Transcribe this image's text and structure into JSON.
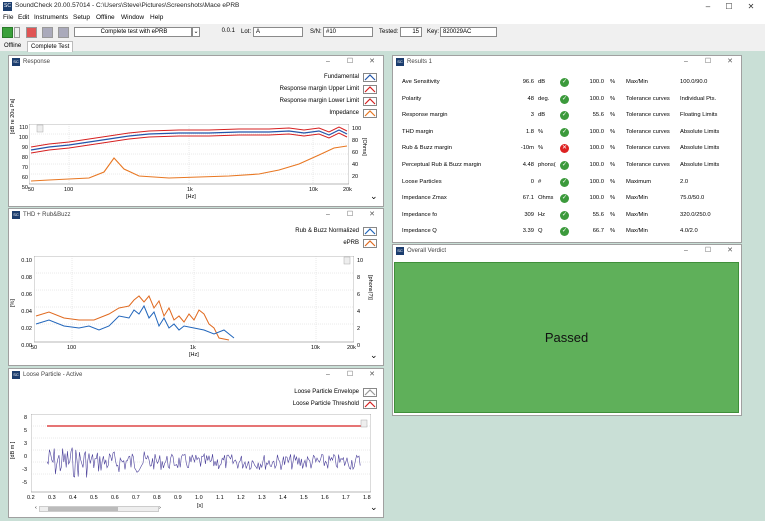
{
  "app": {
    "title": "SoundCheck 20.00.57014 - C:\\Users\\Steve\\Pictures\\Screenshots\\Mace ePRB",
    "icon_text": "SC"
  },
  "menu": [
    "File",
    "Edit",
    "Instruments",
    "Setup",
    "Offline",
    "Window",
    "Help"
  ],
  "toolbar": {
    "sequence": "Complete test with ePRB",
    "version": "0.0.1",
    "lot_label": "Lot:",
    "lot_value": "A",
    "sn_label": "S/N:",
    "sn_value": "#10",
    "tested_label": "Tested:",
    "tested_value": "15",
    "key_label": "Key:",
    "key_value": "820029AC"
  },
  "tabs": [
    "Offline",
    "Complete Test"
  ],
  "response_panel": {
    "title": "Response",
    "legend": [
      "Fundamental",
      "Response margin Upper Limit",
      "Response margin Lower Limit",
      "Impedance"
    ],
    "yleft_ticks": [
      "110",
      "100",
      "90",
      "80",
      "70",
      "60",
      "50"
    ],
    "yright_ticks": [
      "100",
      "80",
      "60",
      "40",
      "20"
    ],
    "ylabel_left": "[dB re 20u Pa]",
    "ylabel_right": "[Ohms]",
    "x_ticks": [
      "50",
      "100",
      "1k",
      "10k",
      "20k"
    ],
    "xlabel": "[Hz]"
  },
  "thd_panel": {
    "title": "THD + Rub&Buzz",
    "legend": [
      "Rub & Buzz Normalized",
      "ePRB"
    ],
    "yleft_ticks": [
      "0.10",
      "0.08",
      "0.06",
      "0.04",
      "0.02",
      "0.00"
    ],
    "yright_ticks": [
      "10",
      "8",
      "6",
      "4",
      "2",
      "0"
    ],
    "ylabel_left": "[%]",
    "ylabel_right": "[phons(?)]",
    "x_ticks": [
      "50",
      "100",
      "1k",
      "10k",
      "20k"
    ],
    "xlabel": "[Hz]"
  },
  "loose_panel": {
    "title": "Loose Particle - Active",
    "legend": [
      "Loose Particle Envelope",
      "Loose Particle Threshold"
    ],
    "y_ticks": [
      "8",
      "5",
      "3",
      "0",
      "-3",
      "-5"
    ],
    "ylabel": "[dB m ]",
    "x_ticks": [
      "0.2",
      "0.3",
      "0.4",
      "0.5",
      "0.6",
      "0.7",
      "0.8",
      "0.9",
      "1.0",
      "1.1",
      "1.2",
      "1.3",
      "1.4",
      "1.5",
      "1.6",
      "1.7",
      "1.8"
    ],
    "xlabel": "[s]"
  },
  "results_panel": {
    "title": "Results 1",
    "rows": [
      {
        "name": "Ave Sensitivity",
        "value": "96.6",
        "unit": "dB",
        "status": "pass",
        "pct": "100.0",
        "pu": "%",
        "method": "Max/Min",
        "limits": "100.0/90.0"
      },
      {
        "name": "Polarity",
        "value": "48",
        "unit": "deg.",
        "status": "pass",
        "pct": "100.0",
        "pu": "%",
        "method": "Tolerance curves",
        "limits": "Individual Pts."
      },
      {
        "name": "Response margin",
        "value": "3",
        "unit": "dB",
        "status": "pass",
        "pct": "55.6",
        "pu": "%",
        "method": "Tolerance curves",
        "limits": "Floating Limits"
      },
      {
        "name": "THD margin",
        "value": "1.8",
        "unit": "%",
        "status": "pass",
        "pct": "100.0",
        "pu": "%",
        "method": "Tolerance curves",
        "limits": "Absolute Limits"
      },
      {
        "name": "Rub & Buzz margin",
        "value": "-10m",
        "unit": "%",
        "status": "fail",
        "pct": "100.0",
        "pu": "%",
        "method": "Tolerance curves",
        "limits": "Absolute Limits"
      },
      {
        "name": "Perceptual Rub & Buzz margin",
        "value": "4.48",
        "unit": "phons(",
        "status": "pass",
        "pct": "100.0",
        "pu": "%",
        "method": "Tolerance curves",
        "limits": "Absolute Limits"
      },
      {
        "name": "Loose Particles",
        "value": "0",
        "unit": "#",
        "status": "pass",
        "pct": "100.0",
        "pu": "%",
        "method": "Maximum",
        "limits": "2.0"
      },
      {
        "name": "Impedance Zmax",
        "value": "67.1",
        "unit": "Ohms",
        "status": "pass",
        "pct": "100.0",
        "pu": "%",
        "method": "Max/Min",
        "limits": "75.0/50.0"
      },
      {
        "name": "Impedance fo",
        "value": "309",
        "unit": "Hz",
        "status": "pass",
        "pct": "55.6",
        "pu": "%",
        "method": "Max/Min",
        "limits": "320.0/250.0"
      },
      {
        "name": "Impedance Q",
        "value": "3.39",
        "unit": "Q",
        "status": "pass",
        "pct": "66.7",
        "pu": "%",
        "method": "Max/Min",
        "limits": "4.0/2.0"
      }
    ]
  },
  "verdict_panel": {
    "title": "Overall Verdict",
    "text": "Passed",
    "color": "#5fb05a"
  },
  "colors": {
    "fundamental": "#2255aa",
    "limits": "#d62020",
    "impedance": "#e87722",
    "rub_buzz": "#2266bb",
    "eprb": "#e06a20",
    "envelope": "#4a3f9a",
    "threshold": "#d62020"
  }
}
